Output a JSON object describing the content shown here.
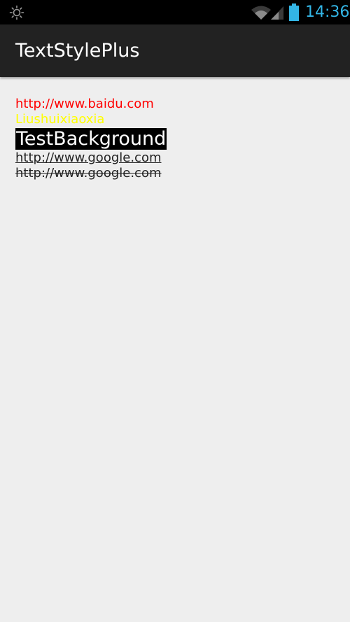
{
  "status_bar": {
    "time": "14:36",
    "left_icon": "brightness-icon",
    "wifi_icon": "wifi-icon",
    "signal_icon": "cell-signal-icon",
    "battery_icon": "battery-icon",
    "accent_color": "#33b5e5"
  },
  "action_bar": {
    "title": "TextStylePlus"
  },
  "content": {
    "red_link": "http://www.baidu.com",
    "yellow_text": "Liushuixiaoxia",
    "background_text": "TestBackground",
    "underline_link": "http://www.google.com",
    "strike_link": "http://www.google.com"
  },
  "colors": {
    "red": "#ff0000",
    "yellow": "#ffff00",
    "background_black": "#000000",
    "page_bg": "#eeeeee",
    "action_bar_bg": "#222222"
  }
}
